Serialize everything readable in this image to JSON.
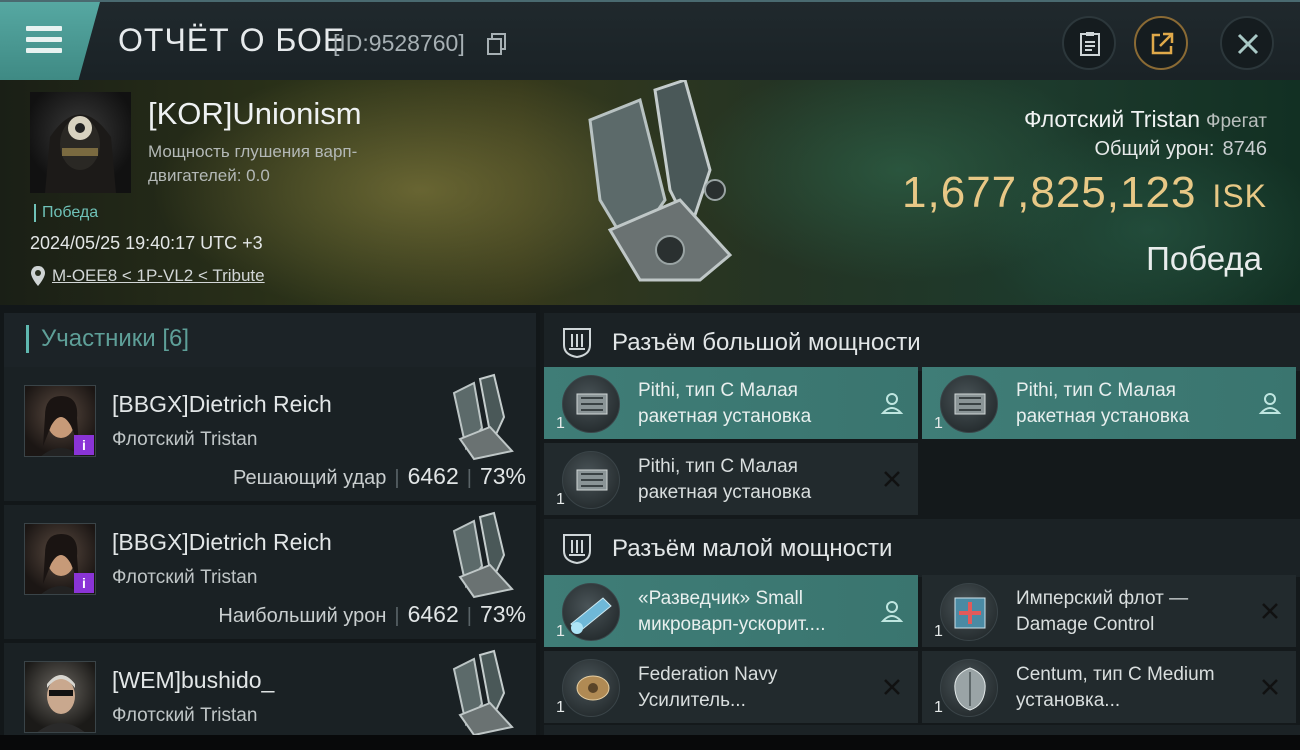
{
  "header": {
    "title": "ОТЧЁТ О БОЕ",
    "report_id": "[ID:9528760]"
  },
  "victim": {
    "name": "[KOR]Unionism",
    "jam_label": "Мощность глушения варп-двигателей: 0.0",
    "result_tag": "Победа",
    "date": "2024/05/25 19:40:17 UTC +3",
    "location": "M-OEE8 < 1P-VL2 < Tribute",
    "ship_name": "Флотский Tristan",
    "ship_class": "Фрегат",
    "total_damage_label": "Общий урон:",
    "total_damage": "8746",
    "isk_value": "1,677,825,123",
    "isk_unit": "ISK",
    "result": "Победа"
  },
  "participants": {
    "title": "Участники [6]",
    "rows": [
      {
        "name": "[BBGX]Dietrich Reich",
        "ship": "Флотский Tristan",
        "role": "Решающий удар",
        "damage": "6462",
        "percent": "73%",
        "badge": "i"
      },
      {
        "name": "[BBGX]Dietrich Reich",
        "ship": "Флотский Tristan",
        "role": "Наибольший урон",
        "damage": "6462",
        "percent": "73%",
        "badge": "i"
      },
      {
        "name": "[WEM]bushido_",
        "ship": "Флотский Tristan",
        "role": "",
        "damage": "",
        "percent": "",
        "badge": ""
      }
    ]
  },
  "modules": {
    "high_slots_title": "Разъём большой мощности",
    "low_slots_title": "Разъём малой мощности",
    "high": [
      {
        "name": "Pithi, тип C Малая ракетная установка",
        "qty": "1",
        "state": "fitted"
      },
      {
        "name": "Pithi, тип C Малая ракетная установка",
        "qty": "1",
        "state": "fitted"
      },
      {
        "name": "Pithi, тип C Малая ракетная установка",
        "qty": "1",
        "state": "destroyed"
      }
    ],
    "low": [
      {
        "name": "«Разведчик» Small микроварп-ускорит....",
        "qty": "1",
        "state": "fitted"
      },
      {
        "name": "Имперский флот — Damage Control",
        "qty": "1",
        "state": "destroyed"
      },
      {
        "name": "Federation Navy Усилитель...",
        "qty": "1",
        "state": "destroyed"
      },
      {
        "name": "Centum, тип C Medium установка...",
        "qty": "1",
        "state": "destroyed"
      }
    ]
  },
  "colors": {
    "accent_teal": "#5fb8b0",
    "isk_gold": "#e8c886",
    "fitted_bg": "#3f7d77",
    "badge_purple": "#8a34d6"
  },
  "icons": [
    "menu-icon",
    "copy-icon",
    "notes-icon",
    "share-icon",
    "close-icon",
    "location-pin-icon",
    "slot-icon",
    "person-icon",
    "cross-icon"
  ]
}
